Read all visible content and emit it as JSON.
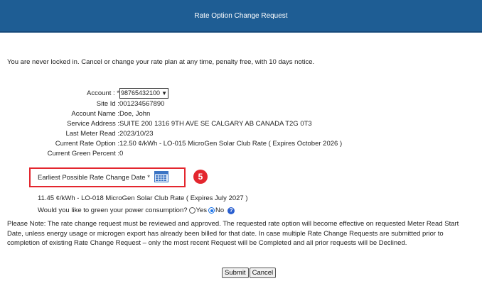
{
  "header": {
    "title": "Rate Option Change Request"
  },
  "intro_text": "You are never locked in. Cancel or change your rate plan at any time, penalty free, with 10 days notice.",
  "account": {
    "label": "Account : ",
    "required_mark": "*",
    "selected": "98765432100"
  },
  "fields": [
    {
      "label": "Site Id :",
      "value": "001234567890"
    },
    {
      "label": "Account Name :",
      "value": "Doe, John"
    },
    {
      "label": "Service Address :",
      "value": "SUITE 200 1316 9TH AVE SE CALGARY AB CANADA T2G 0T3"
    },
    {
      "label": "Last Meter Read :",
      "value": "2023/10/23"
    },
    {
      "label": "Current Rate Option :",
      "value": "12.50 ¢/kWh - LO-015 MicroGen Solar Club Rate ( Expires October 2026 )"
    },
    {
      "label": "Current Green Percent :",
      "value": "0"
    }
  ],
  "rate_change_date": {
    "label": "Earliest Possible Rate Change Date *",
    "icon": "calendar-icon"
  },
  "step_badge": "5",
  "selected_rate": "11.45 ¢/kWh - LO-018 MicroGen Solar Club Rate ( Expires July 2027 )",
  "green_question": {
    "text": "Would you like to green your power consumption?",
    "option_yes": "Yes",
    "option_no": "No",
    "selected": "No"
  },
  "note": "Please Note: The rate change request must be reviewed and approved. The requested rate option will become effective on requested Meter Read Start Date, unless energy usage or microgen export has already been billed for that date. In case multiple Rate Change Requests are submitted prior to completion of existing Rate Change Request – only the most recent Request will be Completed and all prior requests will be Declined.",
  "buttons": {
    "submit": "Submit",
    "cancel": "Cancel"
  },
  "colors": {
    "header_bg": "#1e5d94",
    "highlight": "#e3262e",
    "radio_selected": "#1a73e8"
  }
}
